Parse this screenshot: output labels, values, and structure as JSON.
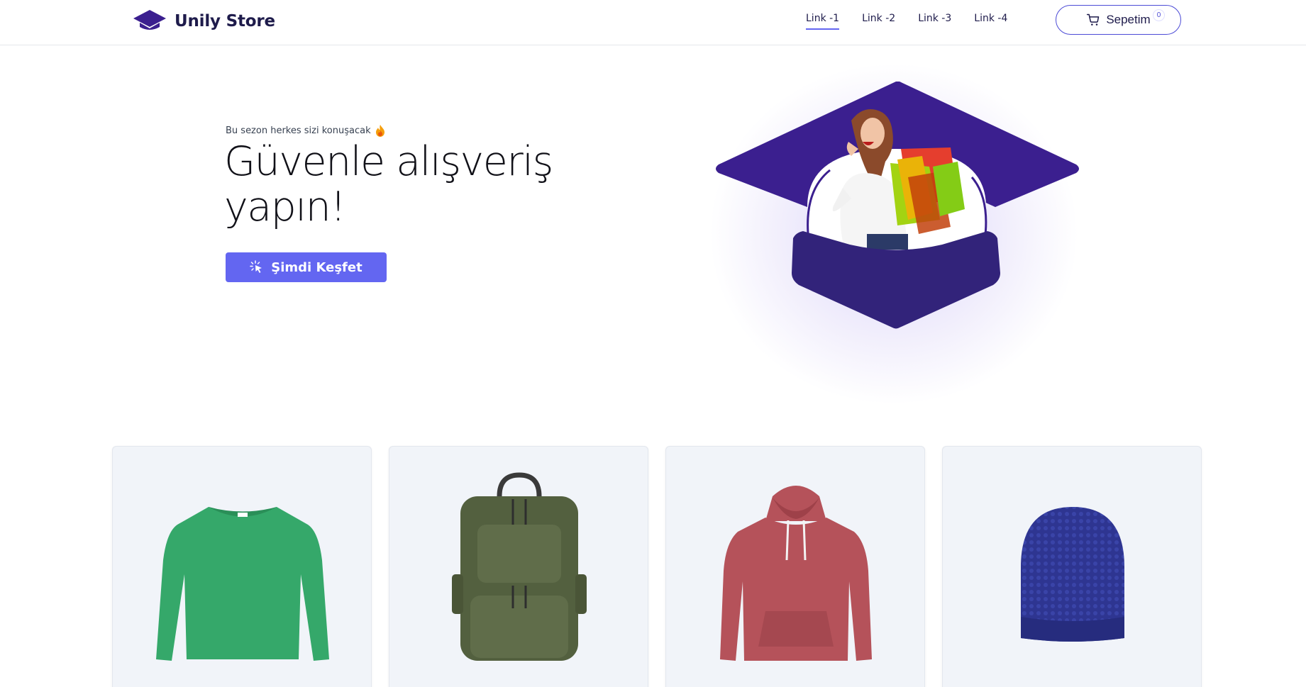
{
  "header": {
    "brand": "Unily Store",
    "nav": [
      {
        "label": "Link -1",
        "active": true
      },
      {
        "label": "Link -2",
        "active": false
      },
      {
        "label": "Link -3",
        "active": false
      },
      {
        "label": "Link -4",
        "active": false
      }
    ],
    "cart": {
      "label": "Sepetim",
      "count": "0"
    }
  },
  "hero": {
    "kicker": "Bu sezon herkes sizi konuşacak",
    "title_line1": "Güvenle alışveriş",
    "title_line2": "yapın!",
    "cta_label": "Şimdi Keşfet"
  },
  "products": [
    {
      "item": "green-sweater"
    },
    {
      "item": "green-backpack"
    },
    {
      "item": "red-hoodie"
    },
    {
      "item": "blue-beanie"
    }
  ],
  "colors": {
    "brand": "#3b1f8f",
    "accent": "#6366f1",
    "text_dark": "#1e1b4b",
    "card_bg": "#f1f4f9"
  },
  "icons": {
    "logo": "graduation-cap-icon",
    "cart": "shopping-cart-icon",
    "kicker": "fire-icon",
    "cta": "cursor-click-icon"
  }
}
